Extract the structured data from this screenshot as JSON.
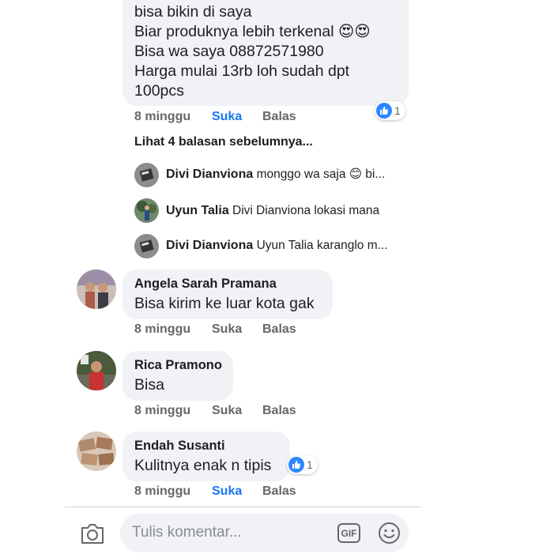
{
  "first_comment": {
    "lines": [
      "bisa bikin di saya",
      "Biar produknya lebih terkenal",
      "Bisa wa saya 08872571980",
      "Harga mulai 13rb loh sudah dpt",
      "100pcs"
    ],
    "emoji": "😍😍",
    "time": "8 minggu",
    "like": "Suka",
    "reply": "Balas",
    "like_count": "1"
  },
  "view_prev_replies": "Lihat 4 balasan sebelumnya...",
  "replies": [
    {
      "name": "Divi Dianviona",
      "text": "monggo wa saja 😊 bi..."
    },
    {
      "name": "Uyun Talia",
      "text": "Divi Dianviona lokasi mana"
    },
    {
      "name": "Divi Dianviona",
      "text": "Uyun Talia karanglo m..."
    }
  ],
  "comments": [
    {
      "name": "Angela Sarah Pramana",
      "text": "Bisa kirim ke luar kota gak",
      "time": "8 minggu",
      "like": "Suka",
      "reply": "Balas"
    },
    {
      "name": "Rica Pramono",
      "text": "Bisa",
      "time": "8 minggu",
      "like": "Suka",
      "reply": "Balas"
    },
    {
      "name": "Endah Susanti",
      "text": "Kulitnya enak n tipis",
      "time": "8 minggu",
      "like": "Suka",
      "reply": "Balas",
      "like_count": "1"
    }
  ],
  "composer": {
    "placeholder": "Tulis komentar...",
    "gif_label": "GIF"
  },
  "colors": {
    "accent": "#1877f2",
    "bubble": "#f0f2f5",
    "meta": "#65676b"
  }
}
